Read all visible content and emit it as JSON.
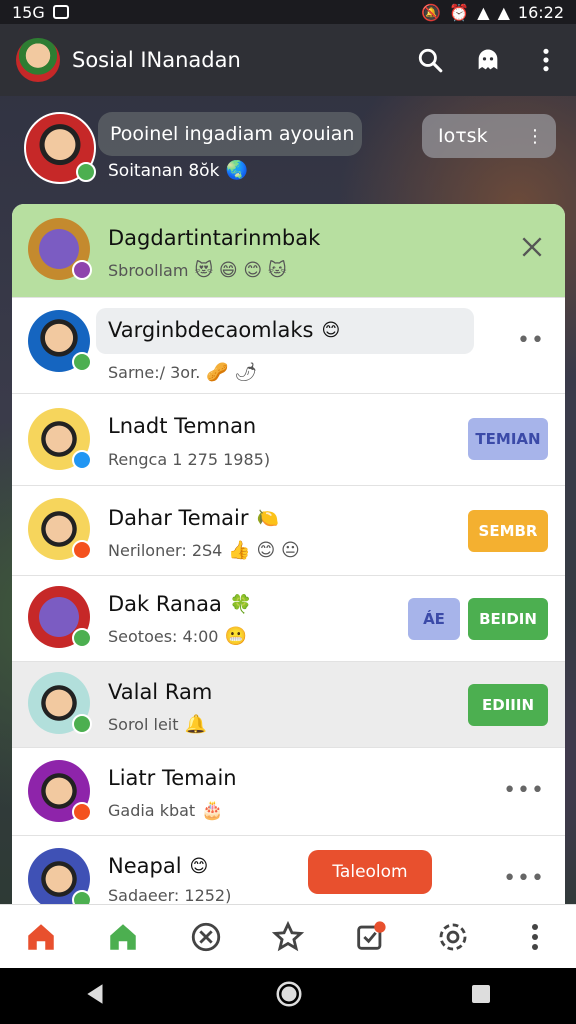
{
  "status_bar": {
    "time_left": "15G",
    "time_right": "16:22"
  },
  "app_bar": {
    "title": "Sosial INanadan"
  },
  "profile": {
    "bubble_text": "Pooinel ingadiam ayouian",
    "subtitle": "Soitanan 8ŏk",
    "pill_label": "Ioτsk"
  },
  "list": {
    "rows": [
      {
        "name": "Dagdartintarinmbak",
        "meta": "Sbroollam",
        "emojis": "😻 😄 😊 🐱"
      },
      {
        "name": "Varginbdecaomlaks",
        "meta": "Sarne:/ 3or.",
        "emojis": "🥜 🌶"
      },
      {
        "name": "Lnadt Temnan",
        "meta": "Rengca 1 275 1985)",
        "tag": "TEMIAN"
      },
      {
        "name": "Dahar Temair",
        "meta": "Neriloner: 2S4",
        "emojis": "👍 😊 😐",
        "tag": "SEMBR"
      },
      {
        "name": "Dak Ranaa",
        "meta": "Seotoes: 4:00",
        "emojis": "😬",
        "tag_a": "ÁE",
        "tag": "BEIDIN"
      },
      {
        "name": "Valal Ram",
        "meta": "Sorol leit",
        "emojis": "🔔",
        "tag": "EDIIIN"
      },
      {
        "name": "Liatr Temain",
        "meta": "Gadia kbat",
        "emojis": "🎂",
        "more": "•••"
      },
      {
        "name": "Neapal",
        "meta": "Sadaeer: 1252)",
        "more": "•••"
      }
    ]
  },
  "toast": {
    "label": "Taleolom"
  },
  "icons": {
    "search": "search-icon",
    "ghost": "ghost-icon",
    "menu": "kebab-menu-icon"
  },
  "colors": {
    "green": "#4caf50",
    "orange": "#f4b030",
    "lilac": "#a7b4ea",
    "red": "#e8502e"
  }
}
